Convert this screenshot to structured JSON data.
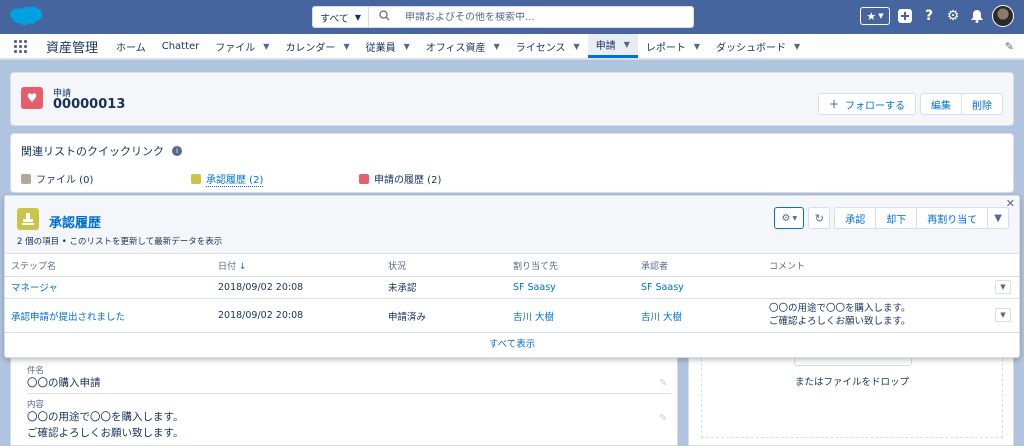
{
  "header": {
    "search_scope": "すべて",
    "search_placeholder": "申請およびその他を検索中...",
    "brand_color": "#46659f"
  },
  "nav": {
    "app_name": "資産管理",
    "items": [
      {
        "label": "ホーム",
        "dropdown": false,
        "active": false
      },
      {
        "label": "Chatter",
        "dropdown": false,
        "active": false
      },
      {
        "label": "ファイル",
        "dropdown": true,
        "active": false
      },
      {
        "label": "カレンダー",
        "dropdown": true,
        "active": false
      },
      {
        "label": "従業員",
        "dropdown": true,
        "active": false
      },
      {
        "label": "オフィス資産",
        "dropdown": true,
        "active": false
      },
      {
        "label": "ライセンス",
        "dropdown": true,
        "active": false
      },
      {
        "label": "申請",
        "dropdown": true,
        "active": true
      },
      {
        "label": "レポート",
        "dropdown": true,
        "active": false
      },
      {
        "label": "ダッシュボード",
        "dropdown": true,
        "active": false
      }
    ]
  },
  "record": {
    "type": "申請",
    "name": "00000013",
    "follow_label": "フォローする",
    "edit_label": "編集",
    "delete_label": "削除"
  },
  "quick_links": {
    "title": "関連リストのクイックリンク",
    "links": [
      {
        "label": "ファイル (0)"
      },
      {
        "label": "承認履歴 (2)"
      },
      {
        "label": "申請の履歴 (2)"
      }
    ]
  },
  "approval_history": {
    "title": "承認履歴",
    "subtitle": "2 個の項目 • このリストを更新して最新データを表示",
    "actions": {
      "approve": "承認",
      "reject": "却下",
      "reassign": "再割り当て"
    },
    "columns": [
      "ステップ名",
      "日付",
      "状況",
      "割り当て先",
      "承認者",
      "コメント"
    ],
    "rows": [
      {
        "step": "マネージャ",
        "date": "2018/09/02 20:08",
        "status": "未承認",
        "assigned_to": "SF Saasy",
        "approver": "SF Saasy",
        "comment_line1": "",
        "comment_line2": ""
      },
      {
        "step": "承認申請が提出されました",
        "date": "2018/09/02 20:08",
        "status": "申請済み",
        "assigned_to": "吉川 大樹",
        "approver": "吉川 大樹",
        "comment_line1": "〇〇の用途で〇〇を購入します。",
        "comment_line2": "ご確認よろしくお願い致します。"
      }
    ],
    "view_all": "すべて表示"
  },
  "details": {
    "subject_label": "件名",
    "subject_value": "〇〇の購入申請",
    "content_label": "内容",
    "content_line1": "〇〇の用途で〇〇を購入します。",
    "content_line2": "ご確認よろしくお願い致します。"
  },
  "files": {
    "drop_text": "またはファイルをドロップ"
  }
}
